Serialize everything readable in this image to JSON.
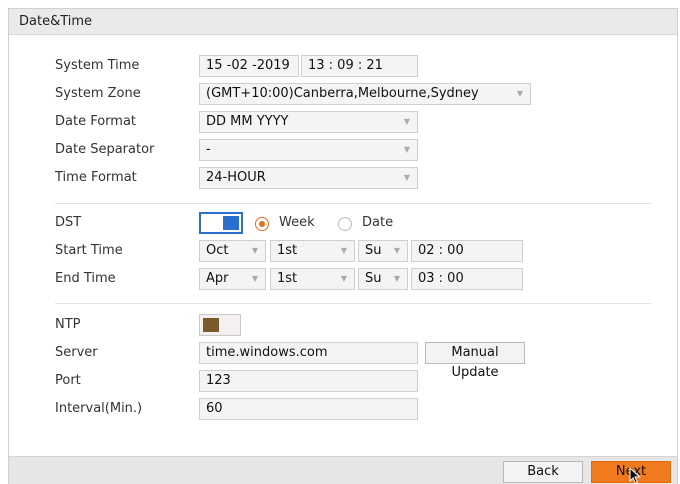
{
  "window": {
    "title": "Date&Time"
  },
  "labels": {
    "system_time": "System Time",
    "system_zone": "System Zone",
    "date_format": "Date Format",
    "date_separator": "Date Separator",
    "time_format": "Time Format",
    "dst": "DST",
    "start_time": "Start Time",
    "end_time": "End Time",
    "ntp": "NTP",
    "server": "Server",
    "port": "Port",
    "interval": "Interval(Min.)"
  },
  "values": {
    "date": "15 -02 -2019",
    "time": "13 : 09 : 21",
    "system_zone": "(GMT+10:00)Canberra,Melbourne,Sydney",
    "date_format": "DD MM YYYY",
    "date_separator": "-",
    "time_format": "24-HOUR",
    "server": "time.windows.com",
    "port": "123",
    "interval": "60"
  },
  "dst": {
    "enabled": true,
    "mode_week_label": "Week",
    "mode_date_label": "Date",
    "selected_mode": "Week",
    "start": {
      "month": "Oct",
      "week": "1st",
      "day": "Su",
      "time": "02 : 00"
    },
    "end": {
      "month": "Apr",
      "week": "1st",
      "day": "Su",
      "time": "03 : 00"
    }
  },
  "ntp": {
    "enabled": false
  },
  "buttons": {
    "manual_update": "Manual Update",
    "back": "Back",
    "next": "Next"
  },
  "icons": {
    "dropdown": "chevron-down-icon",
    "cursor": "mouse-pointer-icon"
  },
  "colors": {
    "accent": "#f07a1d",
    "toggle_on": "#2a6fd0",
    "radio_on": "#e86a1e"
  }
}
